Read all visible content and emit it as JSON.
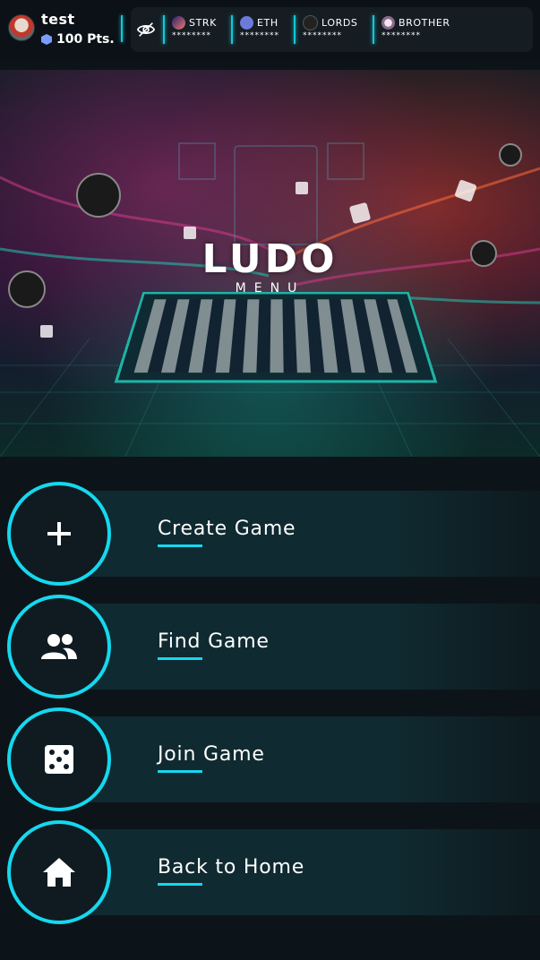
{
  "header": {
    "username": "test",
    "points": "100 Pts.",
    "tokens": [
      {
        "name": "STRK",
        "balance": "********",
        "icon": "strk-icon",
        "color": "#3b2a8c"
      },
      {
        "name": "ETH",
        "balance": "********",
        "icon": "eth-icon",
        "color": "#6c7bd9"
      },
      {
        "name": "LORDS",
        "balance": "********",
        "icon": "lords-icon",
        "color": "#222222"
      },
      {
        "name": "BROTHER",
        "balance": "********",
        "icon": "brother-icon",
        "color": "#d8c8e0"
      }
    ]
  },
  "hero": {
    "title": "LUDO",
    "subtitle": "MENU"
  },
  "menu": {
    "items": [
      {
        "label": "Create Game",
        "icon": "plus-icon"
      },
      {
        "label": "Find Game",
        "icon": "users-icon"
      },
      {
        "label": "Join Game",
        "icon": "dice-icon"
      },
      {
        "label": "Back to Home",
        "icon": "home-icon"
      }
    ]
  },
  "colors": {
    "accent": "#15d8ef",
    "background": "#0d1419",
    "menu_bar": "#0f2a30"
  }
}
